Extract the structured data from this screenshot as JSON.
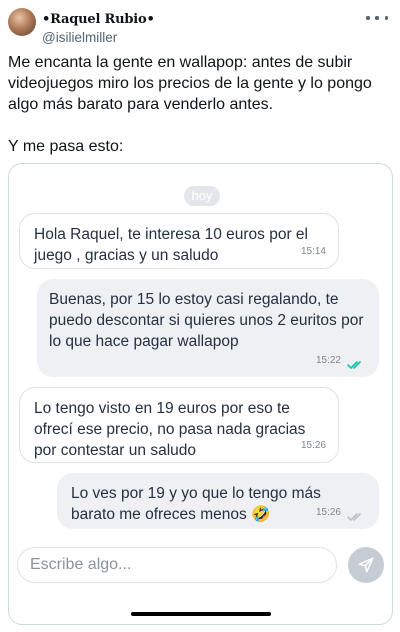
{
  "tweet": {
    "display_name": "•Raquel Rubio•",
    "handle": "@isilielmiller",
    "text_p1": "Me encanta la gente en wallapop: antes de subir videojuegos miro los precios de la gente y lo pongo algo más barato para venderlo antes.",
    "text_p2": "Y me pasa esto:"
  },
  "chat": {
    "day_label": "hoy",
    "messages": [
      {
        "direction": "in",
        "text": "Hola Raquel, te interesa 10 euros por el juego , gracias y un saludo",
        "time": "15:14"
      },
      {
        "direction": "out",
        "text": "Buenas, por 15 lo estoy casi regalando, te puedo descontar si quieres unos 2 euritos por lo que hace pagar wallapop",
        "time": "15:22",
        "read": true
      },
      {
        "direction": "in",
        "text": "Lo tengo visto en 19 euros por eso te ofrecí ese precio, no pasa nada gracias por contestar un saludo",
        "time": "15:26"
      },
      {
        "direction": "out",
        "text": "Lo ves por 19 y yo que lo tengo más barato me ofreces menos 🤣",
        "time": "15:26",
        "read": false
      }
    ],
    "composer": {
      "placeholder": "Escribe algo..."
    }
  },
  "colors": {
    "read_ticks": "#13c1ac",
    "unread_ticks": "#b9c0c7",
    "send_button": "#c5ccd3"
  },
  "icons": {
    "more": "more-dots-icon",
    "send": "send-icon",
    "read": "double-check-icon"
  }
}
